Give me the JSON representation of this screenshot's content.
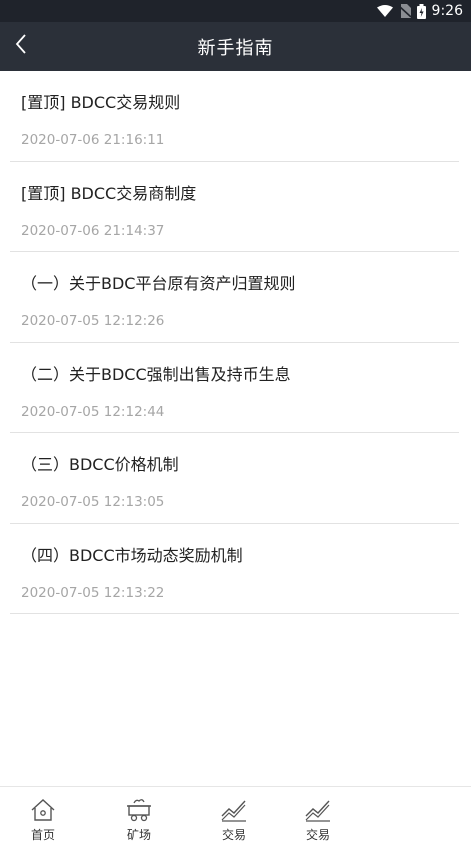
{
  "status_bar": {
    "time": "9:26"
  },
  "header": {
    "title": "新手指南"
  },
  "articles": [
    {
      "title": "[置顶] BDCC交易规则",
      "date": "2020-07-06 21:16:11"
    },
    {
      "title": "[置顶] BDCC交易商制度",
      "date": "2020-07-06 21:14:37"
    },
    {
      "title": "（一）关于BDC平台原有资产归置规则",
      "date": "2020-07-05 12:12:26"
    },
    {
      "title": "（二）关于BDCC强制出售及持币生息",
      "date": "2020-07-05 12:12:44"
    },
    {
      "title": "（三）BDCC价格机制",
      "date": "2020-07-05 12:13:05"
    },
    {
      "title": "（四）BDCC市场动态奖励机制",
      "date": "2020-07-05 12:13:22"
    }
  ],
  "bottom_nav": [
    {
      "label": "首页",
      "icon": "home-icon"
    },
    {
      "label": "矿场",
      "icon": "mining-cart-icon"
    },
    {
      "label": "交易",
      "icon": "chart-trend-icon"
    },
    {
      "label": "交易",
      "icon": "chart-trend-icon"
    }
  ],
  "colors": {
    "status_bar_bg": "#1f232b",
    "header_bg": "#2b3039",
    "title_text": "#222222",
    "date_text": "#a6a6a6",
    "divider": "#e2e2e2"
  }
}
